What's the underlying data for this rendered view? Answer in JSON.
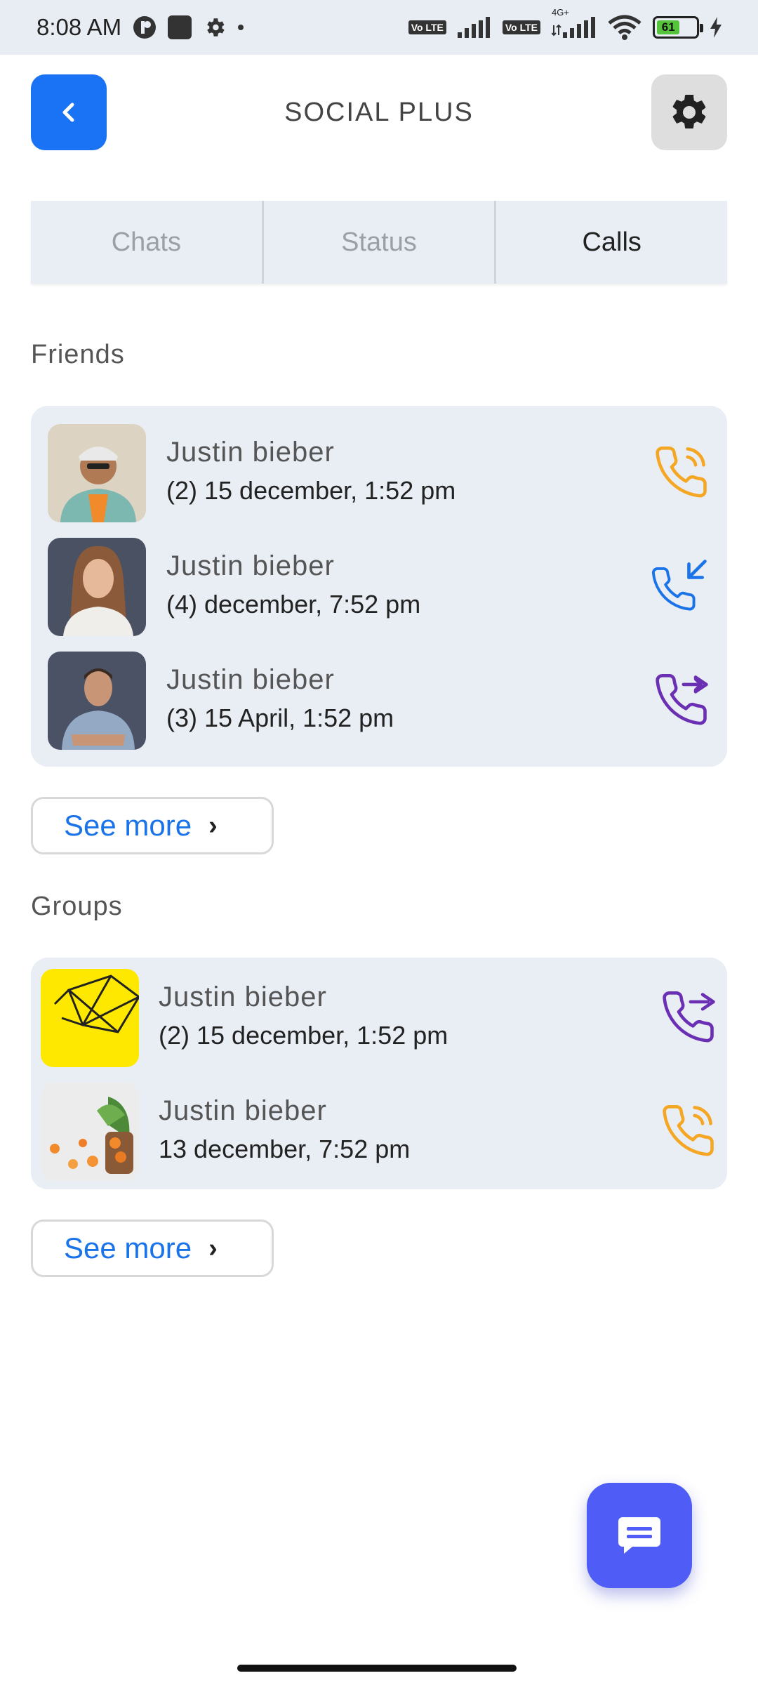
{
  "status_bar": {
    "time": "8:08 AM",
    "network": "4G+",
    "lte_1": "Vo LTE",
    "lte_2": "Vo LTE",
    "battery": "61"
  },
  "header": {
    "title": "SOCIAL PLUS",
    "back_icon": "chevron-left-icon",
    "settings_icon": "gear-icon",
    "accent_color": "#1a73f5"
  },
  "tabs": [
    {
      "label": "Chats",
      "active": false
    },
    {
      "label": "Status",
      "active": false
    },
    {
      "label": "Calls",
      "active": true
    }
  ],
  "friends": {
    "title": "Friends",
    "see_more": "See more",
    "items": [
      {
        "name": "Justin bieber",
        "time": "(2) 15 december, 1:52 pm",
        "call_type": "outgoing-ringing",
        "icon_color": "#f5a623"
      },
      {
        "name": "Justin bieber",
        "time": "(4) december, 7:52 pm",
        "call_type": "incoming",
        "icon_color": "#1a73e8"
      },
      {
        "name": "Justin bieber",
        "time": "(3) 15 April, 1:52 pm",
        "call_type": "forwarded",
        "icon_color": "#6b2fb3"
      }
    ]
  },
  "groups": {
    "title": "Groups",
    "see_more": "See more",
    "items": [
      {
        "name": "Justin bieber",
        "time": "(2) 15 december, 1:52 pm",
        "call_type": "forwarded",
        "icon_color": "#6b2fb3"
      },
      {
        "name": "Justin bieber",
        "time": "13 december, 7:52 pm",
        "call_type": "outgoing-ringing",
        "icon_color": "#f5a623"
      }
    ]
  },
  "fab": {
    "icon": "chat-bubble-icon",
    "color": "#4f5cf5"
  }
}
